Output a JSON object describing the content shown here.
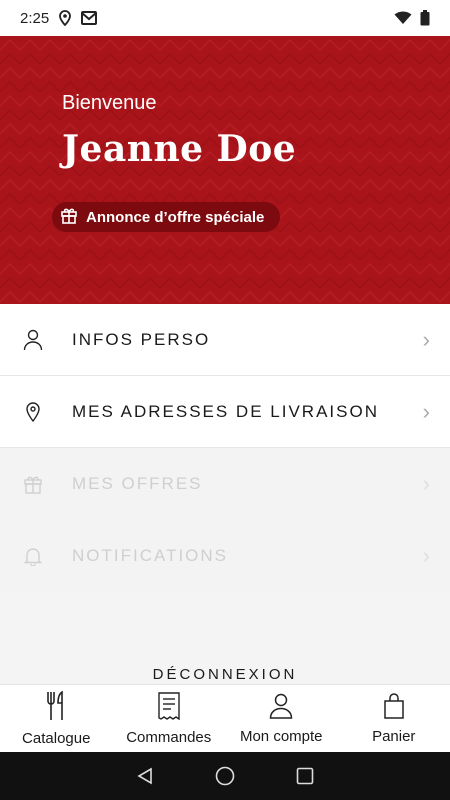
{
  "status_bar": {
    "time": "2:25"
  },
  "hero": {
    "greeting": "Bienvenue",
    "name": "Jeanne Doe",
    "offer_label": "Annonce d’offre spéciale",
    "colors": {
      "background": "#a8141a",
      "pill": "#7d0a0f"
    }
  },
  "menu": {
    "items": [
      {
        "label": "INFOS PERSO",
        "icon": "person-icon",
        "enabled": true
      },
      {
        "label": "MES ADRESSES DE LIVRAISON",
        "icon": "location-pin-icon",
        "enabled": true
      },
      {
        "label": "MES OFFRES",
        "icon": "gift-icon",
        "enabled": false
      },
      {
        "label": "NOTIFICATIONS",
        "icon": "bell-icon",
        "enabled": false
      }
    ]
  },
  "logout_label": "DÉCONNEXION",
  "tabbar": {
    "tabs": [
      {
        "label": "Catalogue",
        "icon": "fork-knife-icon"
      },
      {
        "label": "Commandes",
        "icon": "receipt-icon"
      },
      {
        "label": "Mon compte",
        "icon": "person-icon"
      },
      {
        "label": "Panier",
        "icon": "shopping-bag-icon"
      }
    ]
  }
}
